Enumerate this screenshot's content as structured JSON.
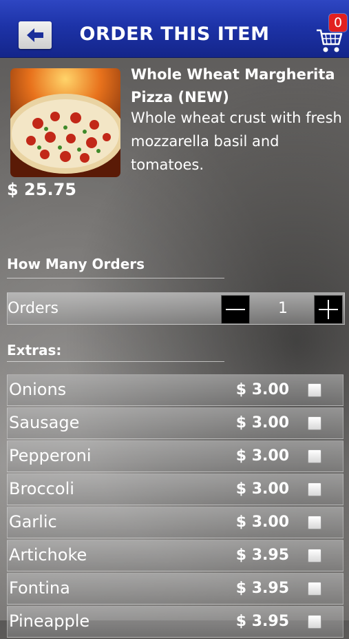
{
  "header": {
    "title": "ORDER THIS ITEM",
    "cart_count": "0"
  },
  "icons": {
    "back": "back-arrow-icon",
    "cart": "shopping-cart-icon"
  },
  "product": {
    "name": "Whole Wheat Margherita Pizza (NEW)",
    "description": "Whole wheat crust with fresh mozzarella basil and tomatoes.",
    "price": "$ 25.75"
  },
  "orders": {
    "section_label": "How Many Orders",
    "label": "Orders",
    "quantity": "1"
  },
  "extras": {
    "section_label": "Extras:",
    "items": [
      {
        "name": "Onions",
        "price": "$ 3.00"
      },
      {
        "name": "Sausage",
        "price": "$ 3.00"
      },
      {
        "name": "Pepperoni",
        "price": "$ 3.00"
      },
      {
        "name": "Broccoli",
        "price": "$ 3.00"
      },
      {
        "name": "Garlic",
        "price": "$ 3.00"
      },
      {
        "name": "Artichoke",
        "price": "$ 3.95"
      },
      {
        "name": "Fontina",
        "price": "$ 3.95"
      },
      {
        "name": "Pineapple",
        "price": "$ 3.95"
      }
    ]
  },
  "colors": {
    "header": "#1d33a8",
    "badge": "#e22020"
  }
}
